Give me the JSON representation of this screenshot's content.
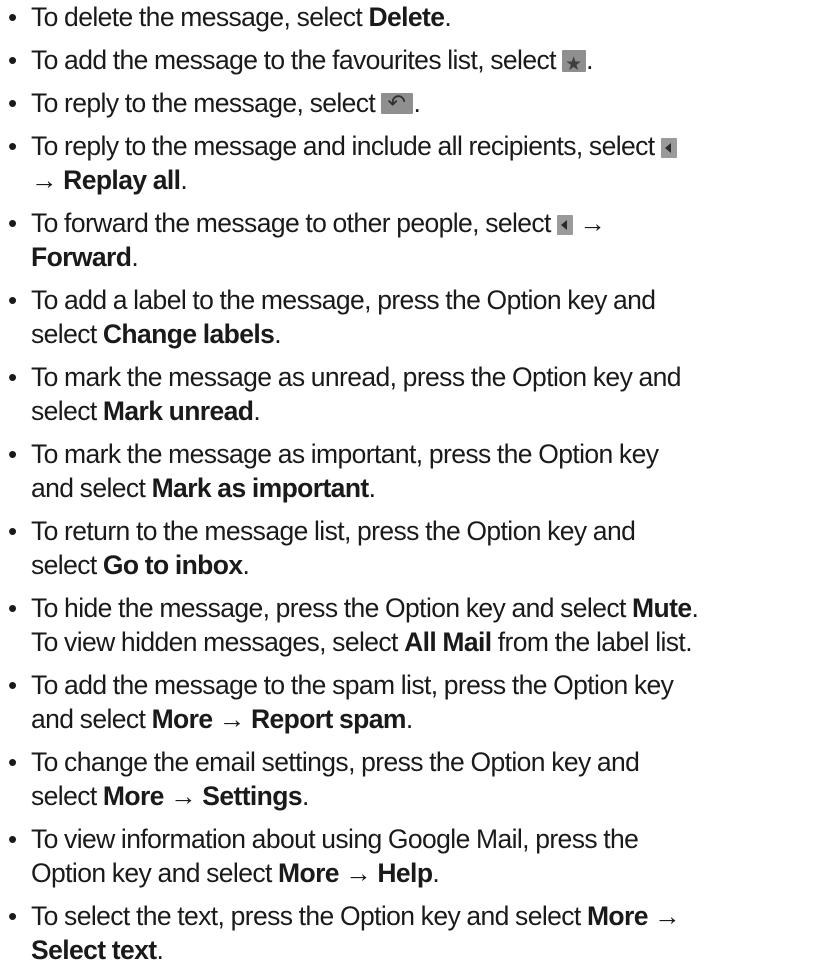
{
  "items": [
    {
      "parts": [
        {
          "t": "To delete the message, select "
        },
        {
          "b": "Delete"
        },
        {
          "t": "."
        }
      ]
    },
    {
      "parts": [
        {
          "t": "To add the message to the favourites list, select "
        },
        {
          "icon": "star"
        },
        {
          "t": "."
        }
      ]
    },
    {
      "parts": [
        {
          "t": "To reply to the message, select "
        },
        {
          "icon": "reply"
        },
        {
          "t": "."
        }
      ]
    },
    {
      "parts": [
        {
          "t": "To reply to the message and include all recipients, select "
        },
        {
          "icon": "more"
        },
        {
          "br": true
        },
        {
          "t": "→ "
        },
        {
          "b": "Replay all"
        },
        {
          "t": "."
        }
      ]
    },
    {
      "parts": [
        {
          "t": "To forward the message to other people, select "
        },
        {
          "icon": "more"
        },
        {
          "t": " →"
        },
        {
          "br": true
        },
        {
          "b": "Forward"
        },
        {
          "t": "."
        }
      ]
    },
    {
      "parts": [
        {
          "t": "To add a label to the message, press the Option key and"
        },
        {
          "br": true
        },
        {
          "t": "select "
        },
        {
          "b": "Change labels"
        },
        {
          "t": "."
        }
      ]
    },
    {
      "parts": [
        {
          "t": "To mark the message as unread, press the Option key and"
        },
        {
          "br": true
        },
        {
          "t": "select "
        },
        {
          "b": "Mark unread"
        },
        {
          "t": "."
        }
      ]
    },
    {
      "parts": [
        {
          "t": "To mark the message as important, press the Option key"
        },
        {
          "br": true
        },
        {
          "t": "and select "
        },
        {
          "b": "Mark as important"
        },
        {
          "t": "."
        }
      ]
    },
    {
      "parts": [
        {
          "t": "To return to the message list, press the Option key and"
        },
        {
          "br": true
        },
        {
          "t": "select "
        },
        {
          "b": "Go to inbox"
        },
        {
          "t": "."
        }
      ]
    },
    {
      "parts": [
        {
          "t": "To hide the message, press the Option key and select "
        },
        {
          "b": "Mute"
        },
        {
          "t": "."
        },
        {
          "br": true
        },
        {
          "t": "To view hidden messages, select "
        },
        {
          "b": "All Mail"
        },
        {
          "t": " from the label list."
        }
      ]
    },
    {
      "parts": [
        {
          "t": "To add the message to the spam list, press the Option key"
        },
        {
          "br": true
        },
        {
          "t": "and select "
        },
        {
          "b": "More"
        },
        {
          "t": " → "
        },
        {
          "b": "Report spam"
        },
        {
          "t": "."
        }
      ]
    },
    {
      "parts": [
        {
          "t": "To change the email settings, press the Option key and"
        },
        {
          "br": true
        },
        {
          "t": "select "
        },
        {
          "b": "More"
        },
        {
          "t": " → "
        },
        {
          "b": "Settings"
        },
        {
          "t": "."
        }
      ]
    },
    {
      "parts": [
        {
          "t": "To view information about using Google Mail, press the"
        },
        {
          "br": true
        },
        {
          "t": "Option key and select "
        },
        {
          "b": "More"
        },
        {
          "t": " → "
        },
        {
          "b": "Help"
        },
        {
          "t": "."
        }
      ]
    },
    {
      "parts": [
        {
          "t": "To select the text, press the Option key and select "
        },
        {
          "b": "More"
        },
        {
          "t": " →"
        },
        {
          "br": true
        },
        {
          "b": "Select text"
        },
        {
          "t": "."
        }
      ]
    }
  ],
  "icons": {
    "star": "favourite-star-icon",
    "reply": "reply-arrow-icon",
    "more": "more-options-arrow-icon"
  },
  "bullet": "•"
}
